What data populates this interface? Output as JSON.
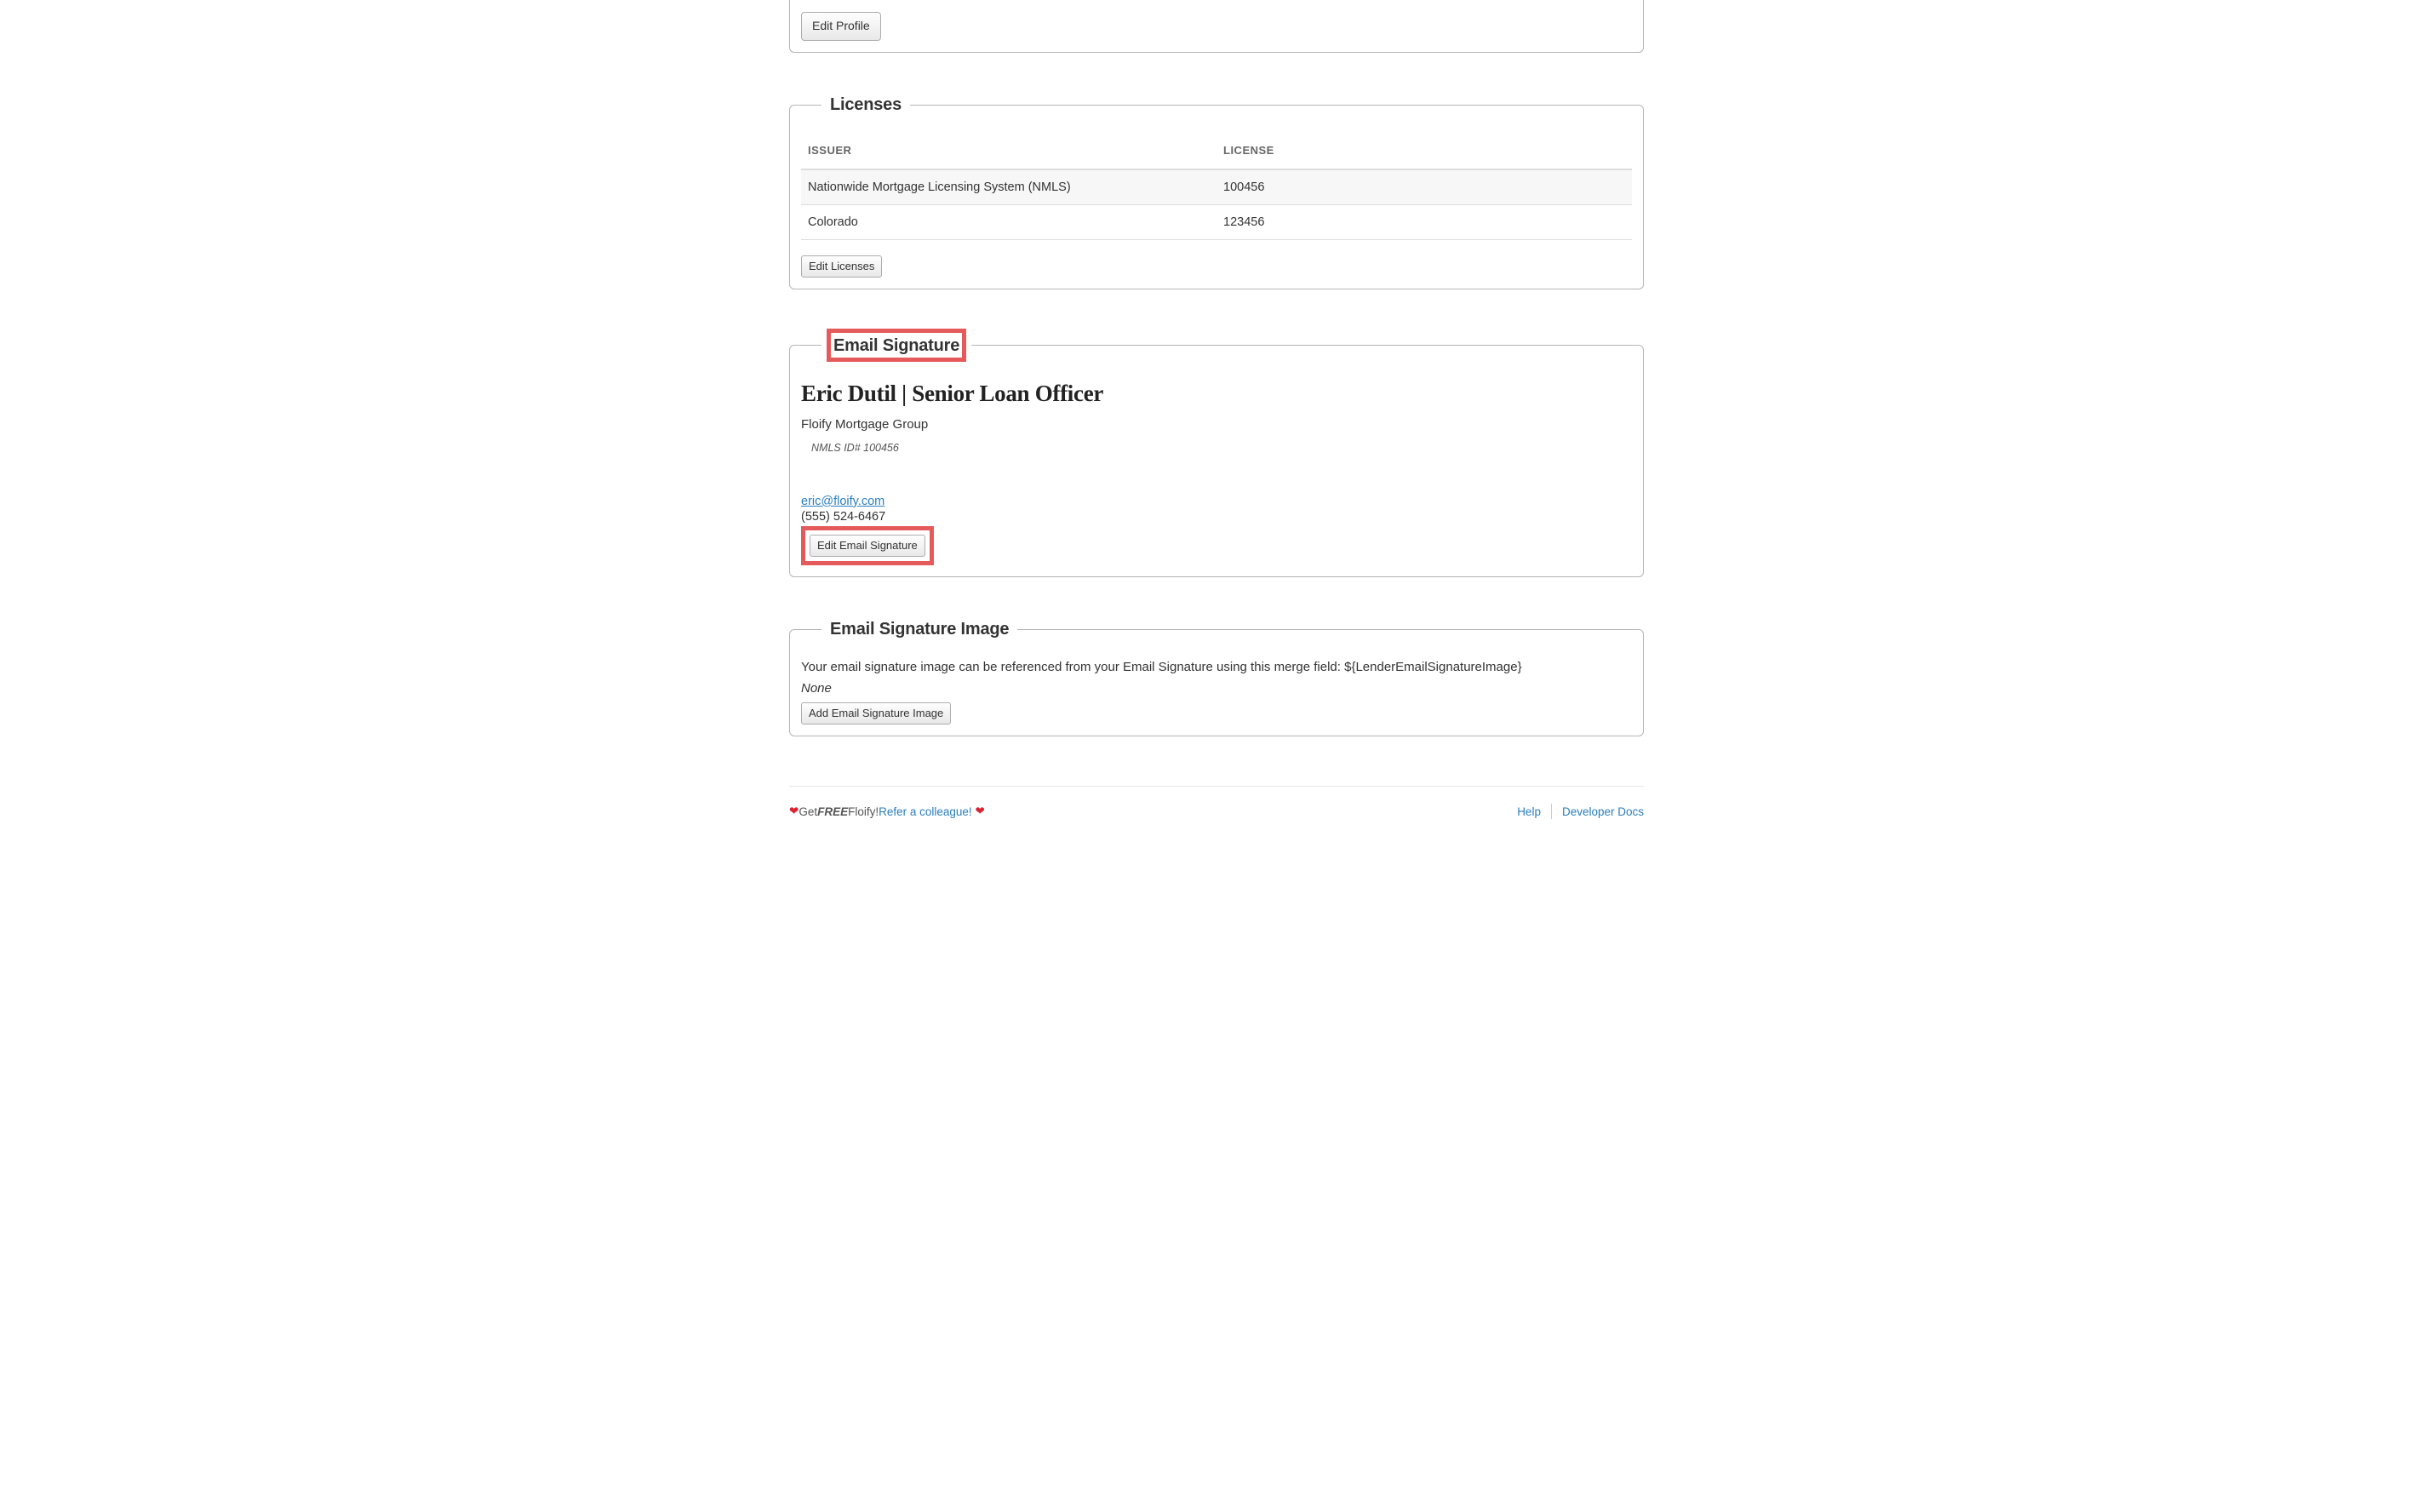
{
  "profile": {
    "edit_btn": "Edit Profile"
  },
  "licenses": {
    "legend": "Licenses",
    "col_issuer": "ISSUER",
    "col_license": "LICENSE",
    "rows": [
      {
        "issuer": "Nationwide Mortgage Licensing System (NMLS)",
        "license": "100456"
      },
      {
        "issuer": "Colorado",
        "license": "123456"
      }
    ],
    "edit_btn": "Edit Licenses"
  },
  "email_sig": {
    "legend": "Email Signature",
    "name_line": "Eric Dutil | Senior Loan Officer",
    "company": "Floify Mortgage Group",
    "nmls": "NMLS ID# 100456",
    "email": "eric@floify.com",
    "phone": "(555) 524-6467",
    "edit_btn": "Edit Email Signature"
  },
  "email_sig_image": {
    "legend": "Email Signature Image",
    "desc": "Your email signature image can be referenced from your Email Signature using this merge field: ${LenderEmailSignatureImage}",
    "none": "None",
    "add_btn": "Add Email Signature Image"
  },
  "footer": {
    "get": " Get ",
    "free": "FREE",
    "floify": " Floify! ",
    "refer": "Refer a colleague!",
    "help": "Help",
    "dev": "Developer Docs"
  }
}
